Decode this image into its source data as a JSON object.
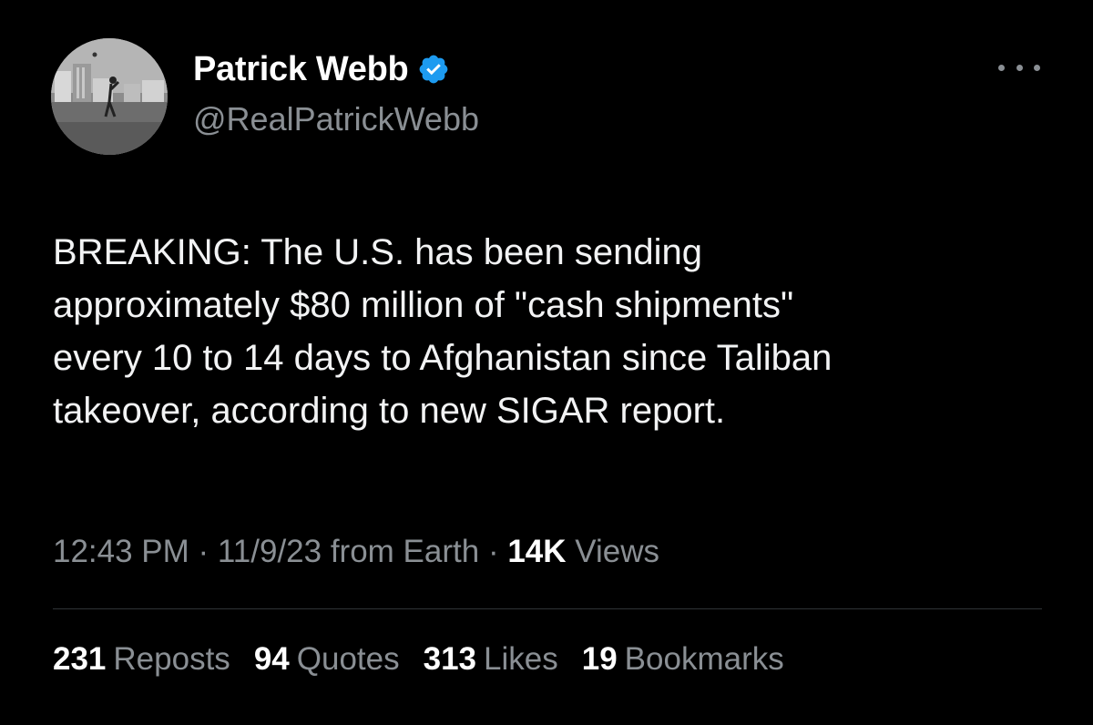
{
  "author": {
    "display_name": "Patrick Webb",
    "handle": "@RealPatrickWebb",
    "verified": true,
    "verified_color": "#1d9bf0",
    "avatar_icon": "avatar-photo"
  },
  "more_icon": "more-horizontal-icon",
  "tweet": {
    "text": "BREAKING: The U.S. has been sending\napproximately $80 million of \"cash shipments\"\nevery 10 to 14 days to Afghanistan since Taliban\ntakeover, according to new SIGAR report."
  },
  "meta": {
    "time": "12:43 PM",
    "sep1": " · ",
    "date": "11/9/23",
    "source": " from Earth",
    "sep2": " · ",
    "views_count": "14K",
    "views_label": " Views"
  },
  "stats": [
    {
      "count": "231",
      "label": "Reposts"
    },
    {
      "count": "94",
      "label": "Quotes"
    },
    {
      "count": "313",
      "label": "Likes"
    },
    {
      "count": "19",
      "label": "Bookmarks"
    }
  ],
  "colors": {
    "background": "#000000",
    "primary_text": "#e7e9ea",
    "secondary_text": "#8a8f94",
    "divider": "#2f3336"
  }
}
